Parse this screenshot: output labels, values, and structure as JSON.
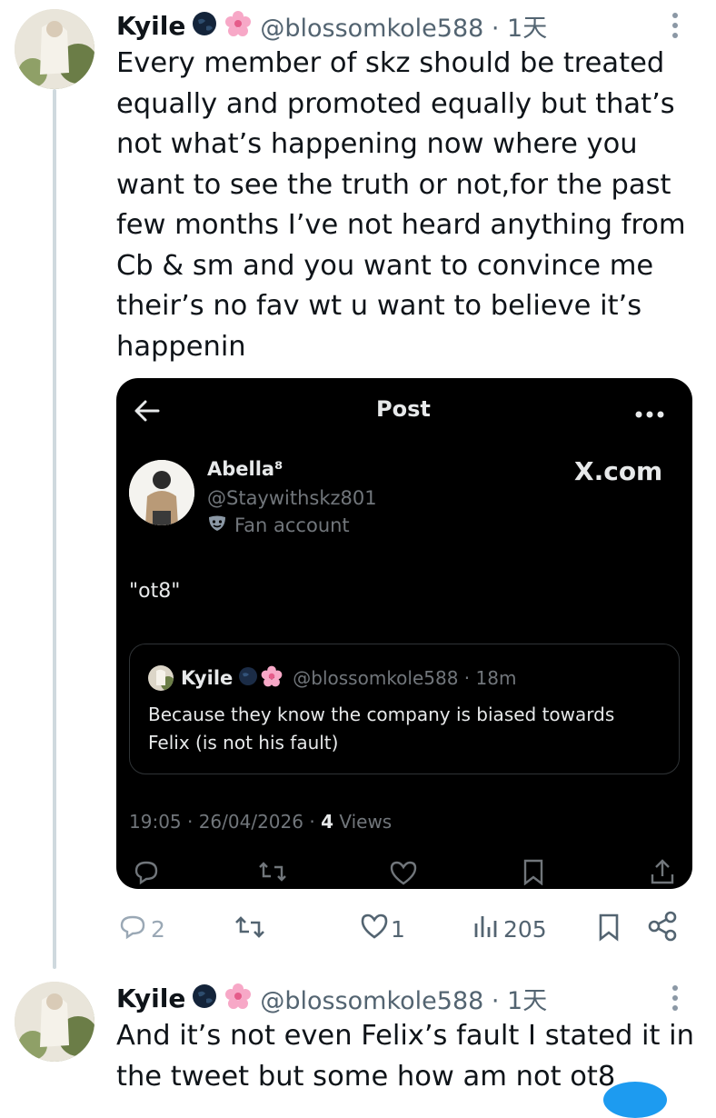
{
  "tweet1": {
    "name": "Kyile",
    "handle": "@blossomkole588 · 1天",
    "text_lines": [
      "Every member of skz should be treated",
      "equally and promoted equally but that’s",
      "not what’s happening now where you",
      "want to see the truth or not,for the past",
      "few months I’ve not heard anything from",
      "Cb & sm and you want to convince me",
      "their’s no fav wt u want to believe it’s",
      "happenin"
    ],
    "actions": {
      "replies": "2",
      "reposts": "",
      "likes": "1",
      "views": "205"
    }
  },
  "embed": {
    "header_title": "Post",
    "author_name": "Abella⁸",
    "author_handle": "@Staywithskz801",
    "author_label": "Fan account",
    "watermark": "X.com",
    "text": "\"ot8\"",
    "quote": {
      "name": "Kyile",
      "handle": "@blossomkole588 · 18m",
      "text_lines": [
        "Because they know the company is biased towards",
        "Felix (is not his fault)"
      ]
    },
    "meta_time": "19:05 · 26/04/2026 · ",
    "meta_views_count": "4",
    "meta_views_label": " Views"
  },
  "tweet2": {
    "name": "Kyile",
    "handle": "@blossomkole588 · 1天",
    "text_lines": [
      "And it’s not even Felix’s fault I stated it in",
      "the tweet but some how am not ot8"
    ]
  },
  "icons": {
    "verified": "dark-globe-icon",
    "flower": "cherry-blossom-icon",
    "accent": "#1d9bf0"
  }
}
